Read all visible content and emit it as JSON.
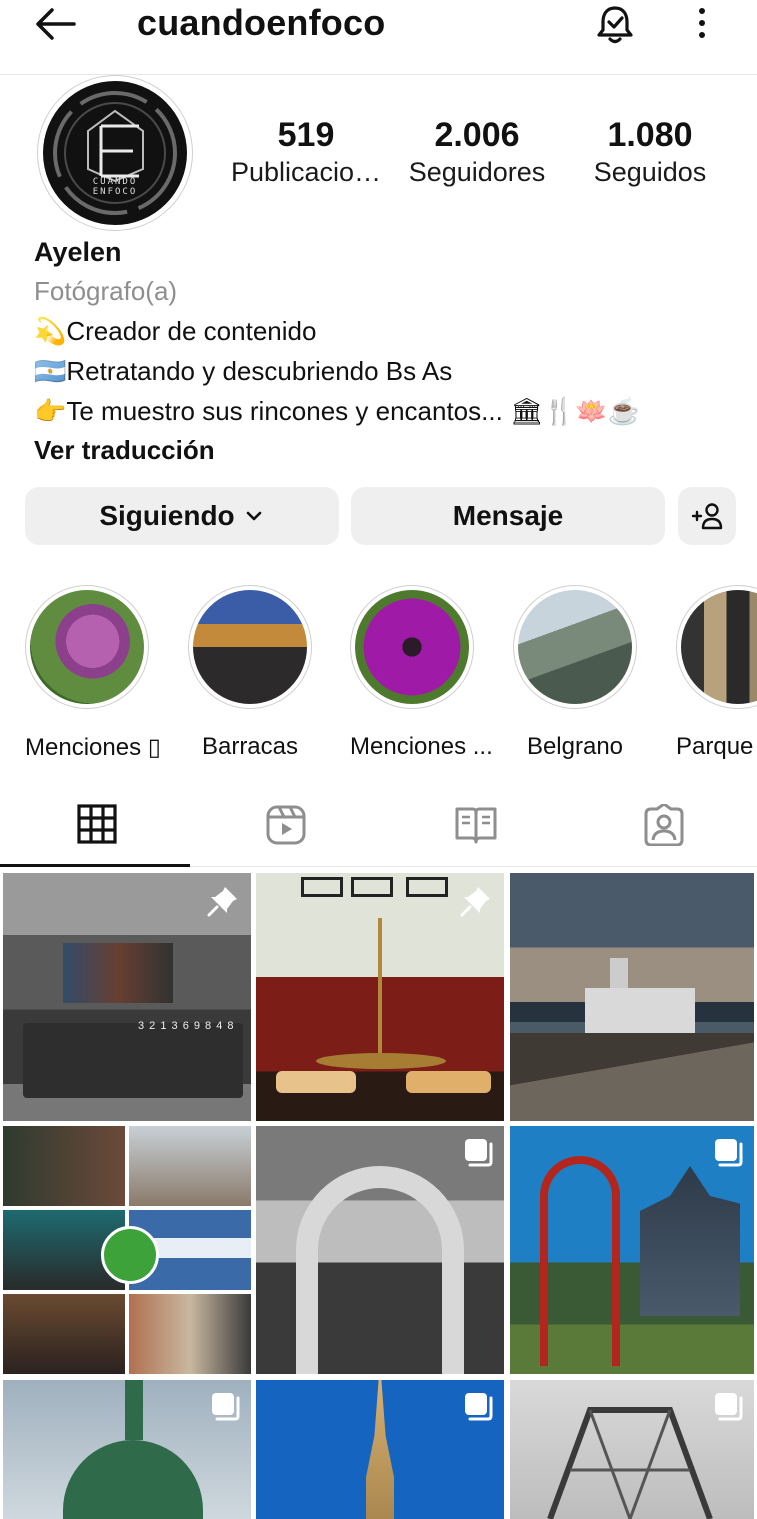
{
  "header": {
    "username": "cuandoenfoco",
    "back_icon": "arrow-left-icon",
    "notification_icon": "bell-check-icon",
    "more_icon": "more-vertical-icon"
  },
  "profile": {
    "avatar_text_line1": "CUANDO",
    "avatar_text_line2": "ENFOCO",
    "stats": [
      {
        "value": "519",
        "label": "Publicacio…"
      },
      {
        "value": "2.006",
        "label": "Seguidores"
      },
      {
        "value": "1.080",
        "label": "Seguidos"
      }
    ],
    "name": "Ayelen",
    "category": "Fotógrafo(a)",
    "bio_lines": [
      "💫Creador de contenido",
      "🇦🇷Retratando y descubriendo Bs As",
      "👉Te muestro sus rincones y encantos... 🏛🍴🪷☕"
    ],
    "translate_link": "Ver traducción"
  },
  "actions": {
    "following_label": "Siguiendo",
    "message_label": "Mensaje",
    "add_friend_icon": "add-person-icon"
  },
  "highlights": [
    {
      "label": "Menciones ▯"
    },
    {
      "label": "Barracas"
    },
    {
      "label": "Menciones ..."
    },
    {
      "label": "Belgrano"
    },
    {
      "label": "Parque P"
    }
  ],
  "tabs": [
    {
      "name": "grid-icon",
      "active": true
    },
    {
      "name": "reels-icon",
      "active": false
    },
    {
      "name": "guides-icon",
      "active": false
    },
    {
      "name": "tagged-icon",
      "active": false
    }
  ],
  "grid": {
    "tiles": [
      {
        "desc": "truck-bw",
        "badge": "pin"
      },
      {
        "desc": "tea-set",
        "badge": "pin"
      },
      {
        "desc": "pier-sunset",
        "badge": "none"
      },
      {
        "desc": "collage",
        "badge": "none",
        "plate_text": "3 2 1 3 6 9 8 4 8"
      },
      {
        "desc": "arch-bw",
        "badge": "multiple"
      },
      {
        "desc": "red-gate",
        "badge": "multiple"
      },
      {
        "desc": "dome-green",
        "badge": "multiple"
      },
      {
        "desc": "tower-blue",
        "badge": "multiple"
      },
      {
        "desc": "bridge",
        "badge": "multiple"
      }
    ]
  }
}
